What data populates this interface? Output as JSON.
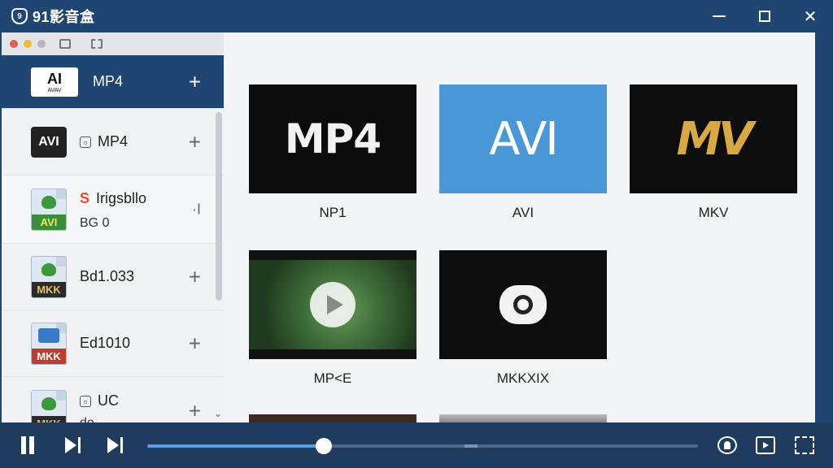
{
  "app": {
    "title": "91影音盒",
    "logo_glyph": "9"
  },
  "window": {
    "minimize": "",
    "maximize": "",
    "close": "✕"
  },
  "colors": {
    "titlebar": "#1f4572",
    "player": "#1f3b5e",
    "accent": "#5b9ae4"
  },
  "sidebar": {
    "items": [
      {
        "icon": "AI",
        "icon_sub": "AVAV",
        "label": "MP4",
        "plus": "+"
      },
      {
        "icon": "AVI",
        "label": "MP4",
        "plus": "+"
      },
      {
        "icon_tag": "AVI",
        "label": "Irigsbllo",
        "sub": "BG 0",
        "plus": "·I"
      },
      {
        "icon_tag": "MKK",
        "label": "Bd1.033",
        "plus": "+"
      },
      {
        "icon_tag": "MKK",
        "label": "Ed1010",
        "plus": "+"
      },
      {
        "icon_tag": "MKK",
        "label": "UC",
        "sub": "do",
        "plus": "+"
      }
    ],
    "scroll_down": "⌄"
  },
  "main": {
    "cards": [
      {
        "thumb_text": "MP4",
        "caption": "NP1"
      },
      {
        "thumb_text": "AVI",
        "caption": "AVI"
      },
      {
        "thumb_text": "MV",
        "caption": "MKV"
      },
      {
        "thumb_text": "",
        "caption": "MP<E"
      },
      {
        "thumb_text": "",
        "caption": "MKKXIX"
      }
    ]
  },
  "player": {
    "progress": 0.32
  }
}
